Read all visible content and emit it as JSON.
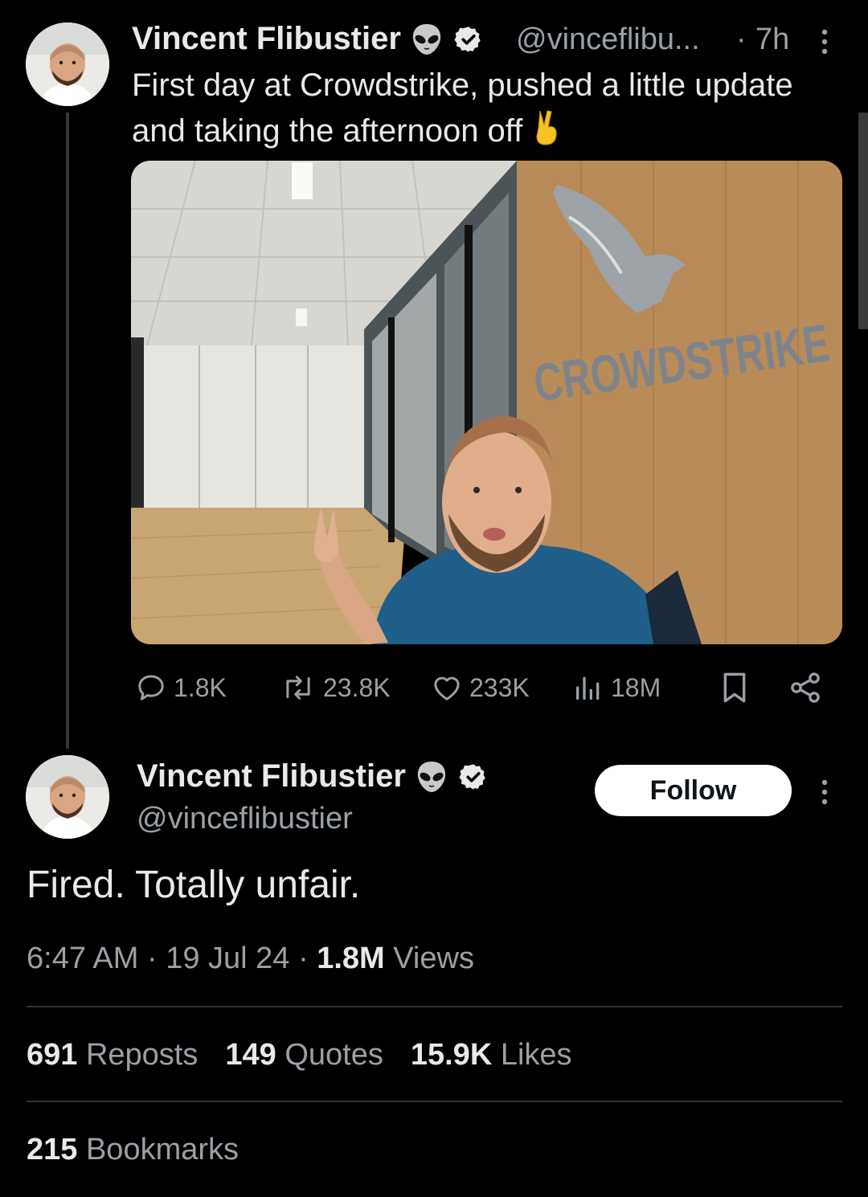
{
  "quoted_tweet": {
    "author_name": "Vincent Flibustier",
    "handle": "@vinceflibu...",
    "separator": "·",
    "time_ago": "7h",
    "text": "First day at Crowdstrike, pushed a little update and taking the afternoon off",
    "emoji_icon": "victory-hand-icon",
    "media_sign_text": "CROWDSTRIKE",
    "actions": {
      "replies": "1.8K",
      "reposts": "23.8K",
      "likes": "233K",
      "views": "18M"
    }
  },
  "main_tweet": {
    "author_name": "Vincent Flibustier",
    "handle": "@vinceflibustier",
    "follow_label": "Follow",
    "text": "Fired. Totally unfair.",
    "time": "6:47 AM",
    "sep1": " · ",
    "date": "19 Jul 24",
    "sep2": " · ",
    "views_count": "1.8M",
    "views_label": " Views",
    "stats": {
      "reposts_count": "691",
      "reposts_label": " Reposts",
      "quotes_count": "149",
      "quotes_label": " Quotes",
      "likes_count": "15.9K",
      "likes_label": " Likes",
      "bookmarks_count": "215",
      "bookmarks_label": " Bookmarks"
    }
  },
  "colors": {
    "background": "#000000",
    "text_primary": "#e7e9ea",
    "text_secondary": "#9aa0a6",
    "verified_badge": "#e7e9ea",
    "divider": "#2f3336"
  }
}
